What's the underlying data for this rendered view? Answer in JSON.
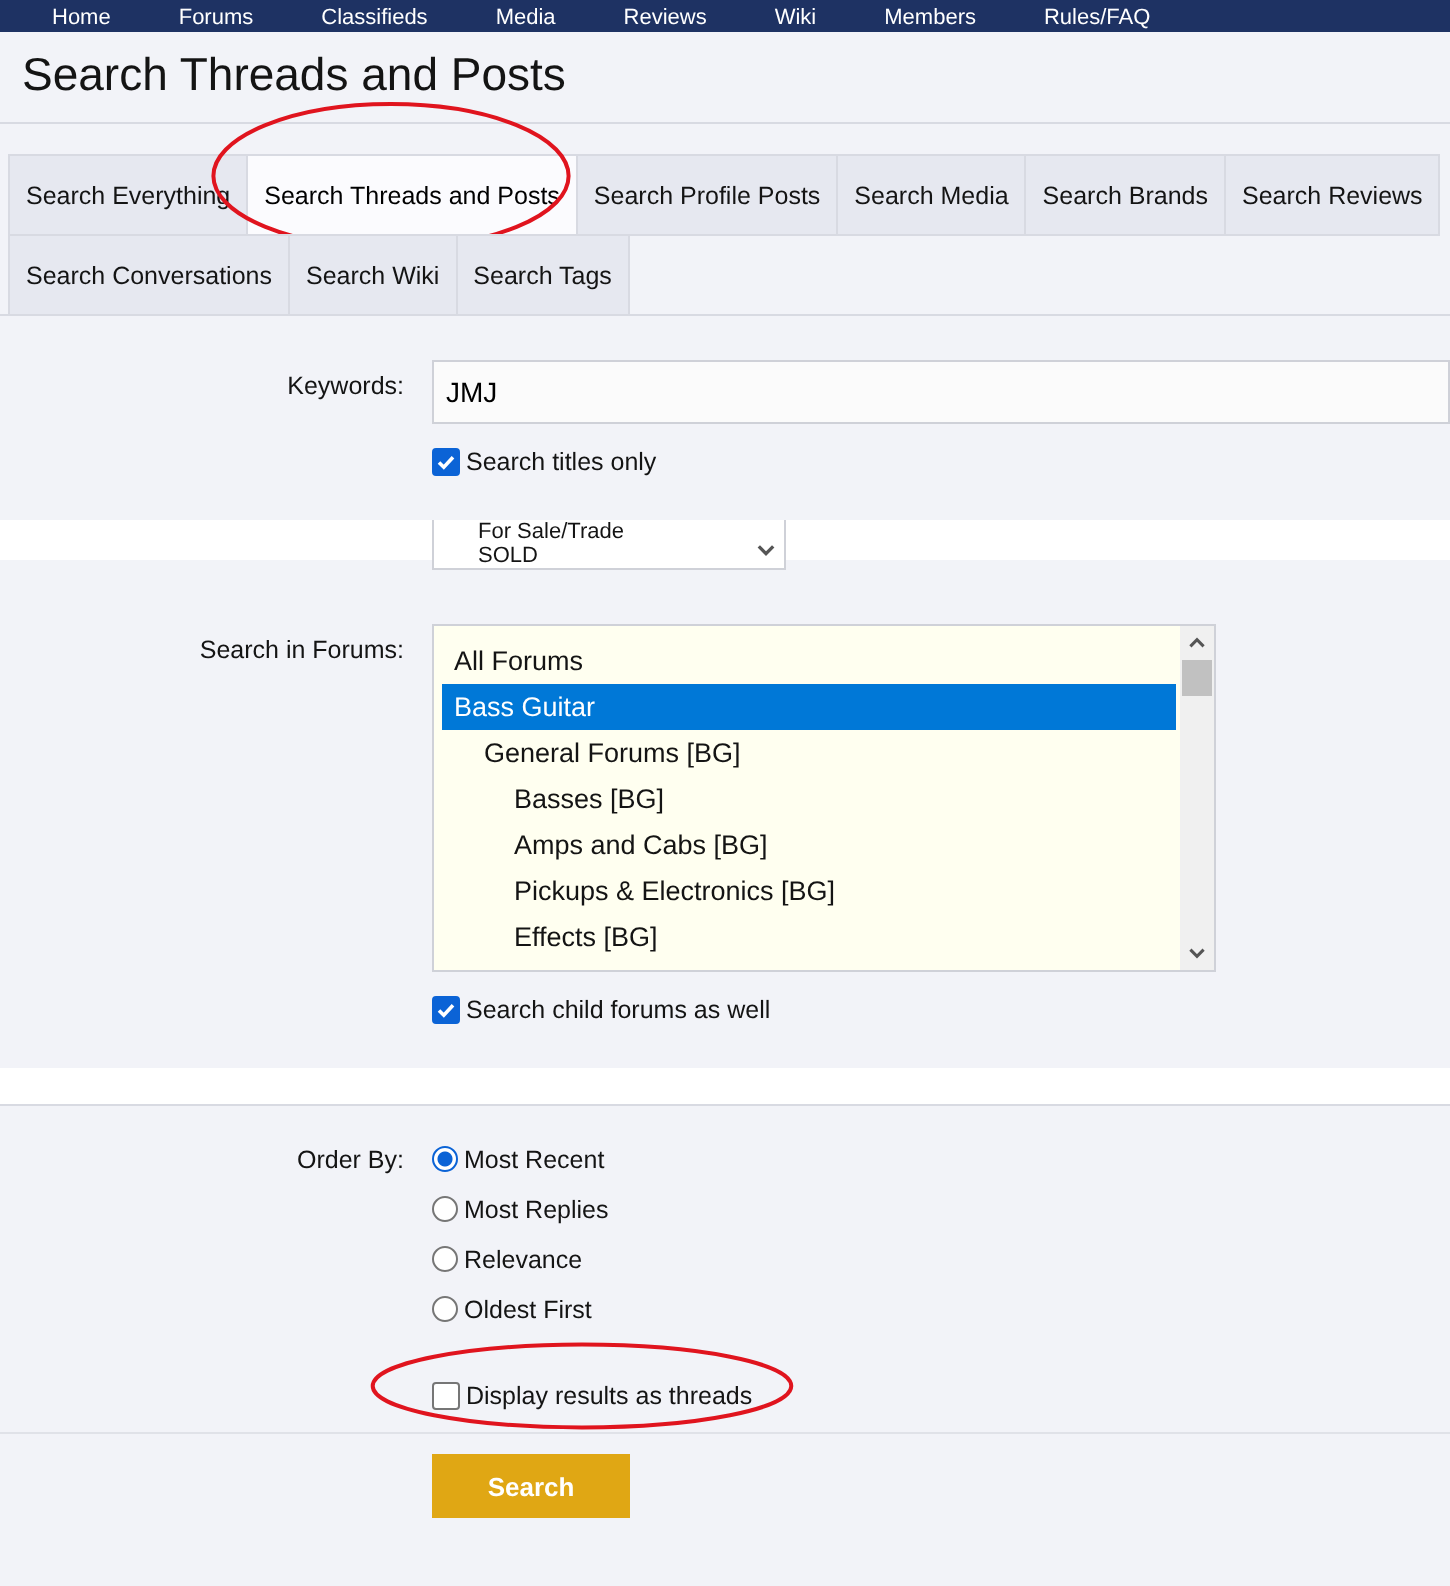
{
  "nav": {
    "items": [
      "Home",
      "Forums",
      "Classifieds",
      "Media",
      "Reviews",
      "Wiki",
      "Members",
      "Rules/FAQ"
    ]
  },
  "page_title": "Search Threads and Posts",
  "tabs": [
    {
      "label": "Search Everything",
      "selected": false,
      "circled": false
    },
    {
      "label": "Search Threads and Posts",
      "selected": true,
      "circled": true
    },
    {
      "label": "Search Profile Posts",
      "selected": false,
      "circled": false
    },
    {
      "label": "Search Media",
      "selected": false,
      "circled": false
    },
    {
      "label": "Search Brands",
      "selected": false,
      "circled": false
    },
    {
      "label": "Search Reviews",
      "selected": false,
      "circled": false
    },
    {
      "label": "Search Conversations",
      "selected": false,
      "circled": false
    },
    {
      "label": "Search Wiki",
      "selected": false,
      "circled": false
    },
    {
      "label": "Search Tags",
      "selected": false,
      "circled": false
    }
  ],
  "keywords": {
    "label": "Keywords:",
    "value": "JMJ",
    "titles_only": {
      "label": "Search titles only",
      "checked": true
    }
  },
  "fragment_select": {
    "items": [
      "For Sale/Trade",
      "SOLD"
    ]
  },
  "forums": {
    "label": "Search in Forums:",
    "items": [
      {
        "label": "All Forums",
        "selected": false
      },
      {
        "label": "Bass Guitar",
        "selected": true,
        "children": [
          {
            "label": "General Forums [BG]",
            "selected": false,
            "children": [
              {
                "label": "Basses [BG]",
                "selected": false
              },
              {
                "label": "Amps and Cabs [BG]",
                "selected": false
              },
              {
                "label": "Pickups & Electronics [BG]",
                "selected": false
              },
              {
                "label": "Effects [BG]",
                "selected": false
              }
            ]
          }
        ]
      }
    ],
    "child_forums": {
      "label": "Search child forums as well",
      "checked": true
    }
  },
  "order_by": {
    "label": "Order By:",
    "options": [
      {
        "label": "Most Recent",
        "selected": true
      },
      {
        "label": "Most Replies",
        "selected": false
      },
      {
        "label": "Relevance",
        "selected": false
      },
      {
        "label": "Oldest First",
        "selected": false
      }
    ]
  },
  "display_threads": {
    "label": "Display results as threads",
    "checked": false,
    "circled": true
  },
  "search_button": "Search"
}
